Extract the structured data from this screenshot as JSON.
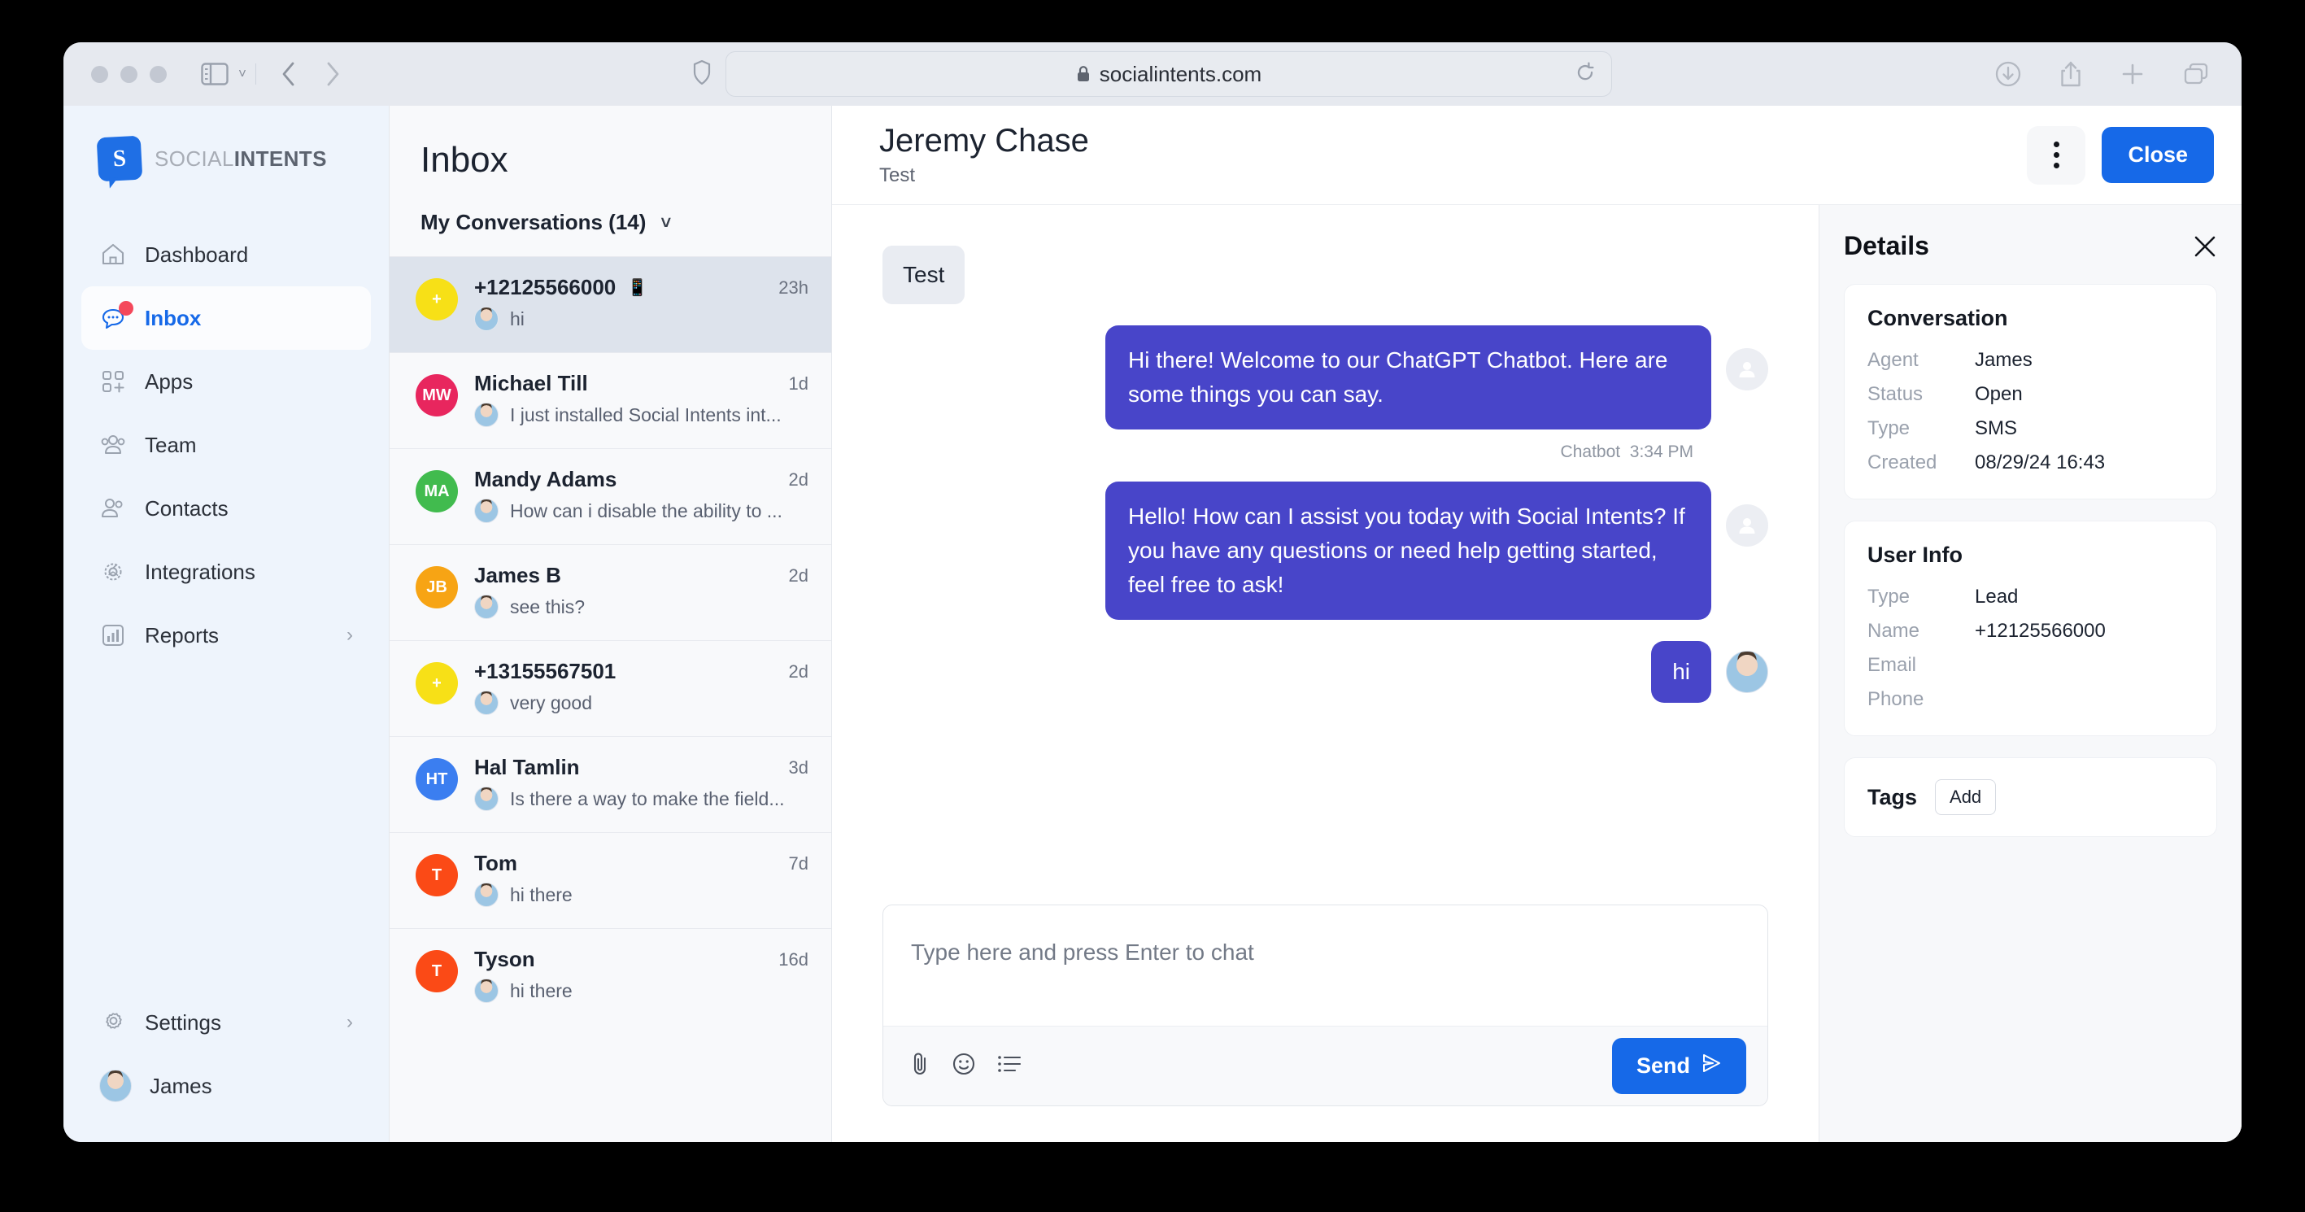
{
  "browser": {
    "url": "socialintents.com",
    "lock_icon": "lock-icon",
    "shield_icon": "shield-icon",
    "sidebar_icon": "sidebar-toggle-icon",
    "back_icon": "back-arrow-icon",
    "forward_icon": "forward-arrow-icon",
    "reload_icon": "reload-icon",
    "downloads_icon": "downloads-icon",
    "share_icon": "share-icon",
    "new_tab_icon": "plus-icon",
    "tabs_icon": "tab-overview-icon"
  },
  "sidebar": {
    "logo": {
      "mark": "S",
      "text_light": "SOCIAL",
      "text_bold": "INTENTS"
    },
    "items": [
      {
        "label": "Dashboard",
        "icon": "home-icon",
        "active": false,
        "badge": false,
        "chevron": false
      },
      {
        "label": "Inbox",
        "icon": "chat-bubble-icon",
        "active": true,
        "badge": true,
        "chevron": false
      },
      {
        "label": "Apps",
        "icon": "apps-grid-plus-icon",
        "active": false,
        "badge": false,
        "chevron": false
      },
      {
        "label": "Team",
        "icon": "team-group-icon",
        "active": false,
        "badge": false,
        "chevron": false
      },
      {
        "label": "Contacts",
        "icon": "contacts-people-icon",
        "active": false,
        "badge": false,
        "chevron": false
      },
      {
        "label": "Integrations",
        "icon": "gear-cog-icon",
        "active": false,
        "badge": false,
        "chevron": false
      },
      {
        "label": "Reports",
        "icon": "bar-chart-icon",
        "active": false,
        "badge": false,
        "chevron": true
      }
    ],
    "settings": {
      "label": "Settings",
      "icon": "gear-icon",
      "chevron": true
    },
    "user": {
      "name": "James",
      "avatar": "user-avatar-photo"
    }
  },
  "inbox": {
    "title": "Inbox",
    "filter_label": "My Conversations (14)",
    "filter_chevron": "chevron-down-icon",
    "conversations": [
      {
        "name": "+12125566000",
        "snippet": "hi",
        "time": "23h",
        "initials": "+",
        "color": "#f7e017",
        "selected": true,
        "phone_icon": true
      },
      {
        "name": "Michael Till",
        "snippet": "I just installed Social Intents int...",
        "time": "1d",
        "initials": "MW",
        "color": "#e8265e",
        "selected": false,
        "phone_icon": false
      },
      {
        "name": "Mandy Adams",
        "snippet": "How can i disable the ability to ...",
        "time": "2d",
        "initials": "MA",
        "color": "#41bb4e",
        "selected": false,
        "phone_icon": false
      },
      {
        "name": "James B",
        "snippet": "see this?",
        "time": "2d",
        "initials": "JB",
        "color": "#f7a414",
        "selected": false,
        "phone_icon": false
      },
      {
        "name": "+13155567501",
        "snippet": "very good",
        "time": "2d",
        "initials": "+",
        "color": "#f7e017",
        "selected": false,
        "phone_icon": false
      },
      {
        "name": "Hal Tamlin",
        "snippet": "Is there a way to make the field...",
        "time": "3d",
        "initials": "HT",
        "color": "#3b7ef0",
        "selected": false,
        "phone_icon": false
      },
      {
        "name": "Tom",
        "snippet": "hi there",
        "time": "7d",
        "initials": "T",
        "color": "#fb4a16",
        "selected": false,
        "phone_icon": false
      },
      {
        "name": "Tyson",
        "snippet": "hi there",
        "time": "16d",
        "initials": "T",
        "color": "#fb4a16",
        "selected": false,
        "phone_icon": false
      }
    ]
  },
  "chat": {
    "contact_name": "Jeremy Chase",
    "subtitle": "Test",
    "kebab_icon": "kebab-menu-icon",
    "close_label": "Close",
    "messages": [
      {
        "side": "in",
        "text": "Test"
      },
      {
        "side": "out",
        "text": "Hi there! Welcome to our ChatGPT Chatbot. Here are some things you can say.",
        "avatar": "generic-user-icon"
      },
      {
        "side": "out",
        "text": "Hello! How can I assist you today with Social Intents? If you have any questions or need help getting started, feel free to ask!",
        "avatar": "generic-user-icon"
      },
      {
        "side": "out",
        "text": "hi",
        "avatar": "agent-photo-avatar",
        "short": true
      }
    ],
    "meta": {
      "author": "Chatbot",
      "time": "3:34 PM"
    },
    "composer": {
      "placeholder": "Type here and press Enter to chat",
      "attach_icon": "paperclip-icon",
      "emoji_icon": "smiley-icon",
      "canned_icon": "list-icon",
      "send_label": "Send",
      "send_icon": "send-plane-icon"
    }
  },
  "details": {
    "title": "Details",
    "close_icon": "close-x-icon",
    "conversation": {
      "heading": "Conversation",
      "rows": [
        {
          "key": "Agent",
          "value": "James"
        },
        {
          "key": "Status",
          "value": "Open"
        },
        {
          "key": "Type",
          "value": "SMS"
        },
        {
          "key": "Created",
          "value": "08/29/24 16:43"
        }
      ]
    },
    "user_info": {
      "heading": "User Info",
      "rows": [
        {
          "key": "Type",
          "value": "Lead"
        },
        {
          "key": "Name",
          "value": "+12125566000"
        },
        {
          "key": "Email",
          "value": ""
        },
        {
          "key": "Phone",
          "value": ""
        }
      ]
    },
    "tags": {
      "label": "Tags",
      "add_label": "Add"
    }
  },
  "colors": {
    "accent_blue": "#1669e8",
    "bubble_indigo": "#4845c9",
    "badge_red": "#f4485b",
    "sidebar_bg": "#eef4fc"
  }
}
